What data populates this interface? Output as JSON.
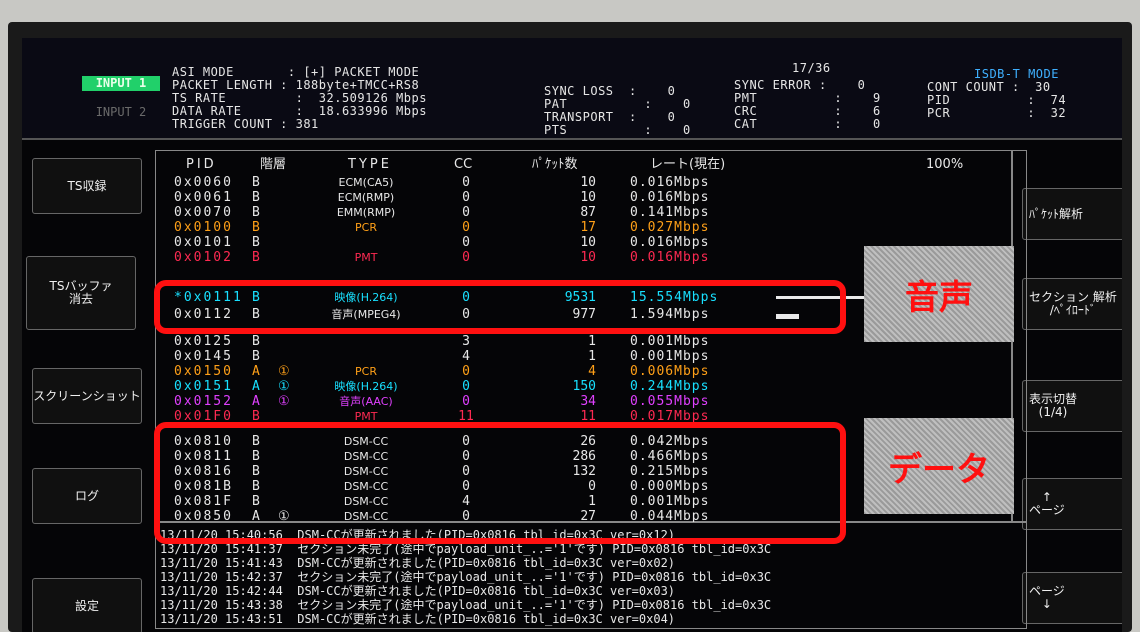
{
  "header": {
    "input1": "INPUT 1",
    "input2": "INPUT 2",
    "line1": "ASI MODE       : [+] PACKET MODE",
    "line2": "PACKET LENGTH : 188byte+TMCC+RS8",
    "line3": "TS RATE         :  32.509126 Mbps",
    "line4": "DATA RATE       :  18.633996 Mbps",
    "line5": "TRIGGER COUNT : 381",
    "page": "17/36",
    "mode": "ISDB-T MODE",
    "stats1": "SYNC LOSS  :    0\nPAT          :    0\nTRANSPORT  :    0\nPTS          :    0",
    "stats2": "SYNC ERROR :    0\nPMT          :    9\nCRC          :    6\nCAT          :    0",
    "stats3": "CONT COUNT :  30\nPID          :  74\nPCR          :  32"
  },
  "table_header": {
    "pid": "PID",
    "layer": "階層",
    "type": "TYPE",
    "cc": "CC",
    "packets": "ﾊﾟｹｯﾄ数",
    "rate": "レート(現在)",
    "percent": "100%"
  },
  "rows": [
    {
      "pid": "0x0060",
      "layer": "B",
      "pt": "",
      "type": "ECM(CA5)",
      "cc": "0",
      "packets": "10",
      "rate": "0.016Mbps",
      "color": "white"
    },
    {
      "pid": "0x0061",
      "layer": "B",
      "pt": "",
      "type": "ECM(RMP)",
      "cc": "0",
      "packets": "10",
      "rate": "0.016Mbps",
      "color": "white"
    },
    {
      "pid": "0x0070",
      "layer": "B",
      "pt": "",
      "type": "EMM(RMP)",
      "cc": "0",
      "packets": "87",
      "rate": "0.141Mbps",
      "color": "white"
    },
    {
      "pid": "0x0100",
      "layer": "B",
      "pt": "",
      "type": "PCR",
      "cc": "0",
      "packets": "17",
      "rate": "0.027Mbps",
      "color": "orange"
    },
    {
      "pid": "0x0101",
      "layer": "B",
      "pt": "",
      "type": "",
      "cc": "0",
      "packets": "10",
      "rate": "0.016Mbps",
      "color": "white"
    },
    {
      "pid": "0x0102",
      "layer": "B",
      "pt": "",
      "type": "PMT",
      "cc": "0",
      "packets": "10",
      "rate": "0.016Mbps",
      "color": "red"
    },
    {
      "pid": "*0x0111",
      "layer": "B",
      "pt": "",
      "type": "映像(H.264)",
      "cc": "0",
      "packets": "9531",
      "rate": "15.554Mbps",
      "color": "cyan"
    },
    {
      "pid": "0x0112",
      "layer": "B",
      "pt": "",
      "type": "音声(MPEG4)",
      "cc": "0",
      "packets": "977",
      "rate": "1.594Mbps",
      "color": "white"
    },
    {
      "pid": "0x0125",
      "layer": "B",
      "pt": "",
      "type": "",
      "cc": "3",
      "packets": "1",
      "rate": "0.001Mbps",
      "color": "white"
    },
    {
      "pid": "0x0145",
      "layer": "B",
      "pt": "",
      "type": "",
      "cc": "4",
      "packets": "1",
      "rate": "0.001Mbps",
      "color": "white"
    },
    {
      "pid": "0x0150",
      "layer": "A",
      "pt": "①",
      "type": "PCR",
      "cc": "0",
      "packets": "4",
      "rate": "0.006Mbps",
      "color": "orange"
    },
    {
      "pid": "0x0151",
      "layer": "A",
      "pt": "①",
      "type": "映像(H.264)",
      "cc": "0",
      "packets": "150",
      "rate": "0.244Mbps",
      "color": "cyan"
    },
    {
      "pid": "0x0152",
      "layer": "A",
      "pt": "①",
      "type": "音声(AAC)",
      "cc": "0",
      "packets": "34",
      "rate": "0.055Mbps",
      "color": "magenta"
    },
    {
      "pid": "0x01F0",
      "layer": "B",
      "pt": "",
      "type": "PMT",
      "cc": "11",
      "packets": "11",
      "rate": "0.017Mbps",
      "color": "red"
    },
    {
      "pid": "0x0810",
      "layer": "B",
      "pt": "",
      "type": "DSM-CC",
      "cc": "0",
      "packets": "26",
      "rate": "0.042Mbps",
      "color": "white"
    },
    {
      "pid": "0x0811",
      "layer": "B",
      "pt": "",
      "type": "DSM-CC",
      "cc": "0",
      "packets": "286",
      "rate": "0.466Mbps",
      "color": "white"
    },
    {
      "pid": "0x0816",
      "layer": "B",
      "pt": "",
      "type": "DSM-CC",
      "cc": "0",
      "packets": "132",
      "rate": "0.215Mbps",
      "color": "white"
    },
    {
      "pid": "0x081B",
      "layer": "B",
      "pt": "",
      "type": "DSM-CC",
      "cc": "0",
      "packets": "0",
      "rate": "0.000Mbps",
      "color": "white"
    },
    {
      "pid": "0x081F",
      "layer": "B",
      "pt": "",
      "type": "DSM-CC",
      "cc": "4",
      "packets": "1",
      "rate": "0.001Mbps",
      "color": "white"
    },
    {
      "pid": "0x0850",
      "layer": "A",
      "pt": "①",
      "type": "DSM-CC",
      "cc": "0",
      "packets": "27",
      "rate": "0.044Mbps",
      "color": "white"
    }
  ],
  "log": [
    "13/11/20 15:40:56  DSM-CCが更新されました(PID=0x0816 tbl_id=0x3C ver=0x12)",
    "13/11/20 15:41:37  セクション未完了(途中でpayload_unit_..='1'です) PID=0x0816 tbl_id=0x3C",
    "13/11/20 15:41:43  DSM-CCが更新されました(PID=0x0816 tbl_id=0x3C ver=0x02)",
    "13/11/20 15:42:37  セクション未完了(途中でpayload_unit_..='1'です) PID=0x0816 tbl_id=0x3C",
    "13/11/20 15:42:44  DSM-CCが更新されました(PID=0x0816 tbl_id=0x3C ver=0x03)",
    "13/11/20 15:43:38  セクション未完了(途中でpayload_unit_..='1'です) PID=0x0816 tbl_id=0x3C",
    "13/11/20 15:43:51  DSM-CCが更新されました(PID=0x0816 tbl_id=0x3C ver=0x04)"
  ],
  "left_buttons": {
    "record": "TS収録",
    "clear": "TSバッファ\n消去",
    "screenshot": "スクリーンショット",
    "log": "ログ",
    "settings": "設定"
  },
  "right_buttons": {
    "packet": "ﾊﾟｹｯﾄ解析",
    "section": "セクション 解析\n/ﾍﾟｲﾛｰﾄﾞ",
    "display": "表示切替\n(1/4)",
    "page_up": "↑\nページ",
    "page_down": "ページ\n↓"
  },
  "annotations": {
    "audio": "音声",
    "data": "データ"
  },
  "bars": {
    "row_0x0111": 0.98,
    "row_0x0112": 0.1
  }
}
